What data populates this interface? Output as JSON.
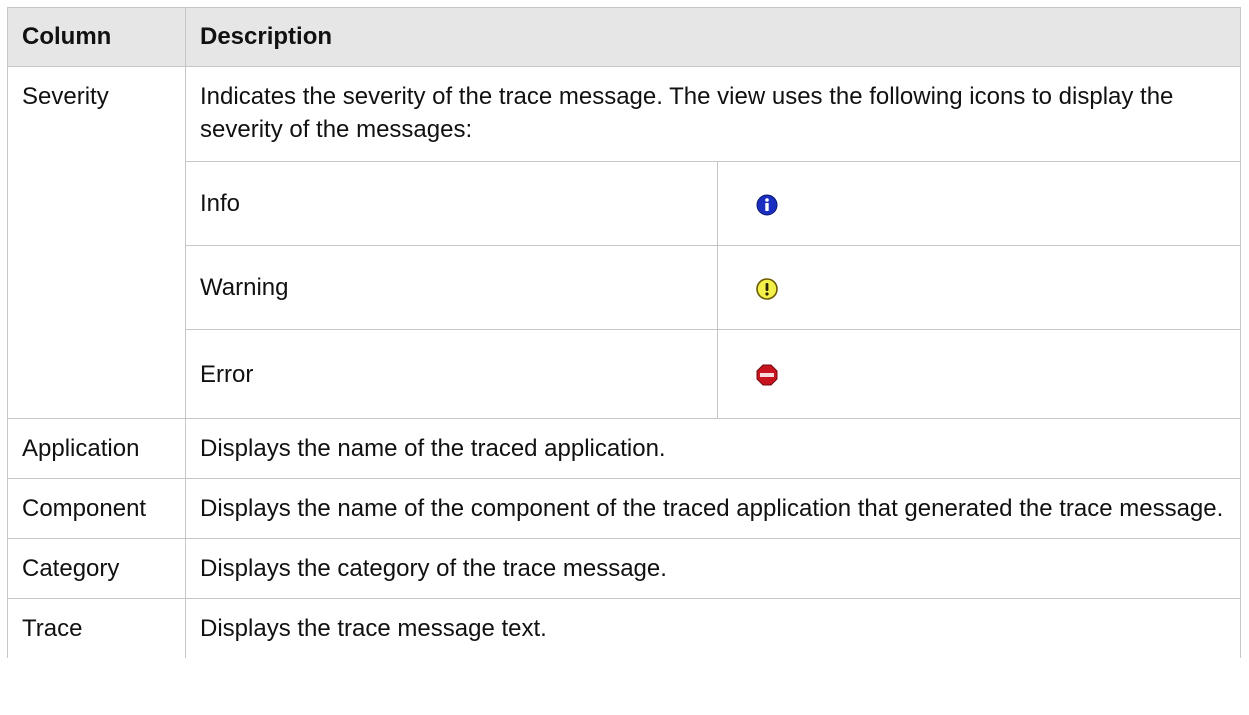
{
  "table": {
    "headers": {
      "column": "Column",
      "description": "Description"
    },
    "severity": {
      "name": "Severity",
      "description": "Indicates the severity of the trace message. The view uses the following icons to display the severity of the messages:",
      "levels": [
        {
          "label": "Info",
          "icon": "info-icon",
          "color": "#1a2fbf"
        },
        {
          "label": "Warning",
          "icon": "warning-icon",
          "color": "#f4f04a"
        },
        {
          "label": "Error",
          "icon": "stop-icon",
          "color": "#c8141e"
        }
      ]
    },
    "rows": [
      {
        "name": "Application",
        "description": "Displays the name of the traced application."
      },
      {
        "name": "Component",
        "description": "Displays the name of the component of the traced application that generated the trace message."
      },
      {
        "name": "Category",
        "description": "Displays the category of the trace message."
      },
      {
        "name": "Trace",
        "description": "Displays the trace message text."
      }
    ]
  }
}
